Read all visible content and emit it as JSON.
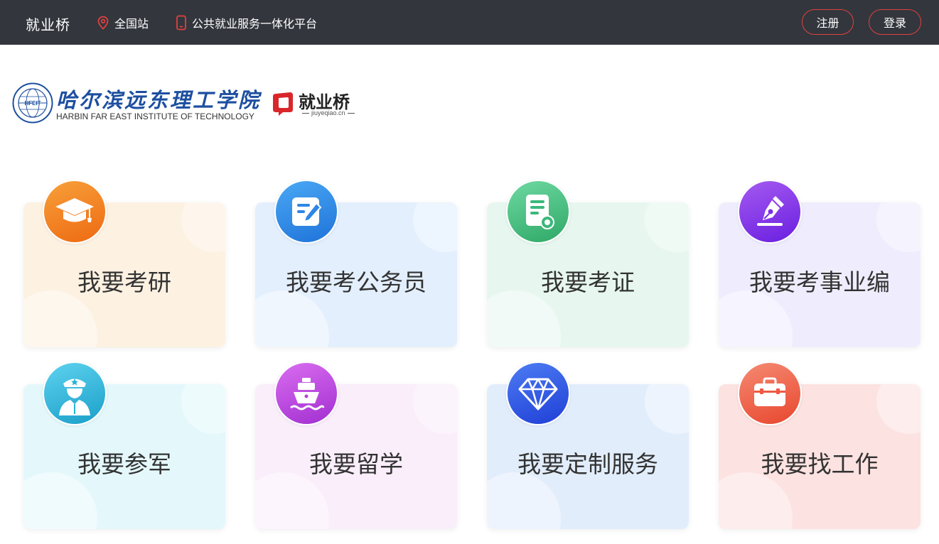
{
  "header": {
    "brand": "就业桥",
    "location_label": "全国站",
    "platform_label": "公共就业服务一体化平台",
    "register_label": "注册",
    "login_label": "登录",
    "accent_color": "#e0413f",
    "background_color": "#33363d"
  },
  "logos": {
    "school_name_cn": "哈尔滨远东理工学院",
    "school_name_en": "HARBIN FAR EAST INSTITUTE OF TECHNOLOGY",
    "school_seal_text": "HFEIT",
    "platform_name": "就业桥",
    "platform_url": "jiuyeqiao.cn"
  },
  "services": [
    {
      "label": "我要考研",
      "icon": "graduation-cap-icon",
      "card_color": "#fdf1e2",
      "icon_color": "#f07a1d"
    },
    {
      "label": "我要考公务员",
      "icon": "edit-document-icon",
      "card_color": "#e3effd",
      "icon_color": "#2e86e6"
    },
    {
      "label": "我要考证",
      "icon": "certificate-icon",
      "card_color": "#e7f7ef",
      "icon_color": "#3ab97a"
    },
    {
      "label": "我要考事业编",
      "icon": "pen-nib-icon",
      "card_color": "#efedfd",
      "icon_color": "#7a2fe6"
    },
    {
      "label": "我要参军",
      "icon": "soldier-icon",
      "card_color": "#e4f8fc",
      "icon_color": "#27b1d6"
    },
    {
      "label": "我要留学",
      "icon": "ship-icon",
      "card_color": "#faeefb",
      "icon_color": "#b63fd9"
    },
    {
      "label": "我要定制服务",
      "icon": "diamond-icon",
      "card_color": "#e2edfc",
      "icon_color": "#2f54e0"
    },
    {
      "label": "我要找工作",
      "icon": "briefcase-icon",
      "card_color": "#fce2e0",
      "icon_color": "#ee5a44"
    }
  ]
}
